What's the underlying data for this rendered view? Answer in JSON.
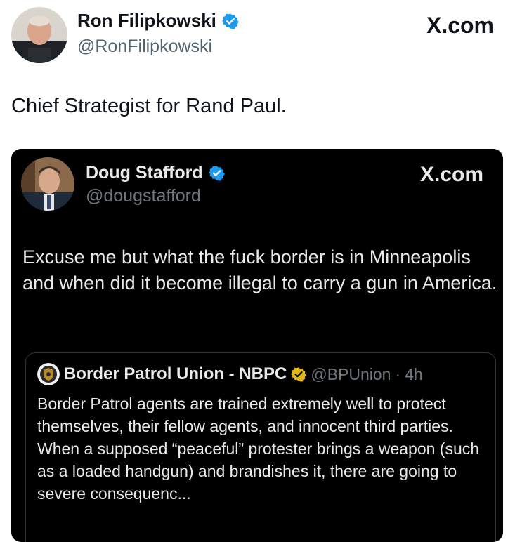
{
  "outer": {
    "author_name": "Ron Filipkowski",
    "handle": "@RonFilipkowski",
    "brand": "X.com",
    "text": "Chief Strategist for Rand Paul.",
    "verified_icon": "verified-badge-blue"
  },
  "quoted": {
    "author_name": "Doug Stafford",
    "handle": "@dougstafford",
    "brand": "X.com",
    "text": "Excuse me but what the fuck border is in Minneapolis and when did it become illegal to carry a gun in America.",
    "verified_icon": "verified-badge-blue"
  },
  "nested": {
    "author_name": "Border Patrol Union - NBPC",
    "handle": "@BPUnion",
    "separator": "·",
    "time": "4h",
    "text": "Border Patrol agents are trained extremely well to protect themselves, their fellow agents, and innocent third parties. When a supposed “peaceful” protester brings a weapon (such as a loaded handgun) and brandishes it, there are going to severe consequenc...",
    "verified_icon": "verified-badge-gold"
  },
  "colors": {
    "verified_blue": "#1d9bf0",
    "verified_gold": "#e2b719",
    "dark_bg": "#000000",
    "light_text": "#e7e9ea",
    "muted_text": "#71767b"
  }
}
